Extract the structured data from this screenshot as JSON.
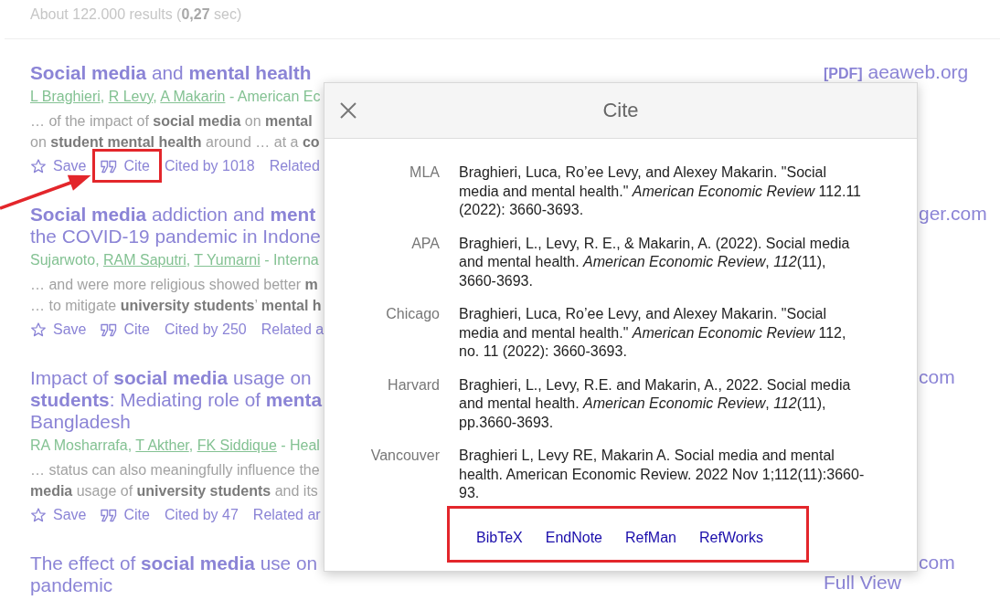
{
  "results_summary": "About 122.000 results (**0,27** sec)",
  "results": [
    {
      "title_lines": [
        "**Social media** and **mental health**"
      ],
      "byline": {
        "authors": [
          {
            "name": "L Braghieri",
            "linked": true,
            "after": ", "
          },
          {
            "name": "R Levy",
            "linked": true,
            "after": ", "
          },
          {
            "name": "A Makarin",
            "linked": true
          }
        ],
        "venue": " - American Ec"
      },
      "snippet_lines": [
        "… of the impact of **social media** on **mental**",
        "on **student mental health** around … at a **co**"
      ],
      "actions": [
        {
          "kind": "save",
          "label": "Save",
          "highlighted": false
        },
        {
          "kind": "cite",
          "label": "Cite",
          "highlighted": true
        },
        {
          "kind": "cited_by",
          "label": "Cited by 1018",
          "highlighted": false
        },
        {
          "kind": "related",
          "label": "Related",
          "highlighted": false
        }
      ],
      "side_links": [
        {
          "tag": "[PDF]",
          "text": "aeaweb.org"
        }
      ]
    },
    {
      "title_lines": [
        "**Social media** addiction and **ment**",
        "the COVID-19 pandemic in Indone"
      ],
      "byline": {
        "authors": [
          {
            "name": "Sujarwoto",
            "linked": false,
            "after": ", "
          },
          {
            "name": "RAM Saputri",
            "linked": true,
            "after": ", "
          },
          {
            "name": "T Yumarni",
            "linked": true
          }
        ],
        "venue": " - Interna"
      },
      "snippet_lines": [
        "… and were more religious showed better **m**",
        "… to mitigate **university students**’ **mental h**"
      ],
      "actions": [
        {
          "kind": "save",
          "label": "Save",
          "highlighted": false
        },
        {
          "kind": "cite",
          "label": "Cite",
          "highlighted": false
        },
        {
          "kind": "cited_by",
          "label": "Cited by 250",
          "highlighted": false
        },
        {
          "kind": "related",
          "label": "Related a",
          "highlighted": false
        }
      ],
      "side_links": [
        {
          "text": "ger.com"
        }
      ]
    },
    {
      "title_lines": [
        "Impact of **social media** usage on",
        "**students**: Mediating role of **menta**",
        "Bangladesh"
      ],
      "byline": {
        "authors": [
          {
            "name": "RA Mosharrafa",
            "linked": false,
            "after": ", "
          },
          {
            "name": "T Akther",
            "linked": true,
            "after": ", "
          },
          {
            "name": "FK Siddique",
            "linked": true
          }
        ],
        "venue": " - Heal"
      },
      "snippet_lines": [
        "… status can also meaningfully influence the",
        "**media** usage of **university students** and its"
      ],
      "actions": [
        {
          "kind": "save",
          "label": "Save",
          "highlighted": false
        },
        {
          "kind": "cite",
          "label": "Cite",
          "highlighted": false
        },
        {
          "kind": "cited_by",
          "label": "Cited by 47",
          "highlighted": false
        },
        {
          "kind": "related",
          "label": "Related ar",
          "highlighted": false
        }
      ],
      "side_links": [
        {
          "text": "com"
        }
      ]
    },
    {
      "title_lines": [
        "The effect of **social media** use on",
        "pandemic"
      ],
      "side_links": [
        {
          "text": "com"
        },
        {
          "text": "Full View"
        }
      ]
    }
  ],
  "modal": {
    "title": "Cite",
    "citations": [
      {
        "style": "MLA",
        "text": "Braghieri, Luca, Ro’ee Levy, and Alexey Makarin. \"Social media and mental health.\" *American Economic Review* 112.11 (2022): 3660-3693."
      },
      {
        "style": "APA",
        "text": "Braghieri, L., Levy, R. E., & Makarin, A. (2022). Social media and mental health. *American Economic Review*, *112*(11), 3660-3693."
      },
      {
        "style": "Chicago",
        "text": "Braghieri, Luca, Ro’ee Levy, and Alexey Makarin. \"Social media and mental health.\" *American Economic Review* 112, no. 11 (2022): 3660-3693."
      },
      {
        "style": "Harvard",
        "text": "Braghieri, L., Levy, R.E. and Makarin, A., 2022. Social media and mental health. *American Economic Review*, *112*(11), pp.3660-3693."
      },
      {
        "style": "Vancouver",
        "text": "Braghieri L, Levy RE, Makarin A. Social media and mental health. American Economic Review. 2022 Nov 1;112(11):3660-93."
      }
    ],
    "export": {
      "highlighted": true,
      "links": [
        "BibTeX",
        "EndNote",
        "RefMan",
        "RefWorks"
      ]
    }
  }
}
